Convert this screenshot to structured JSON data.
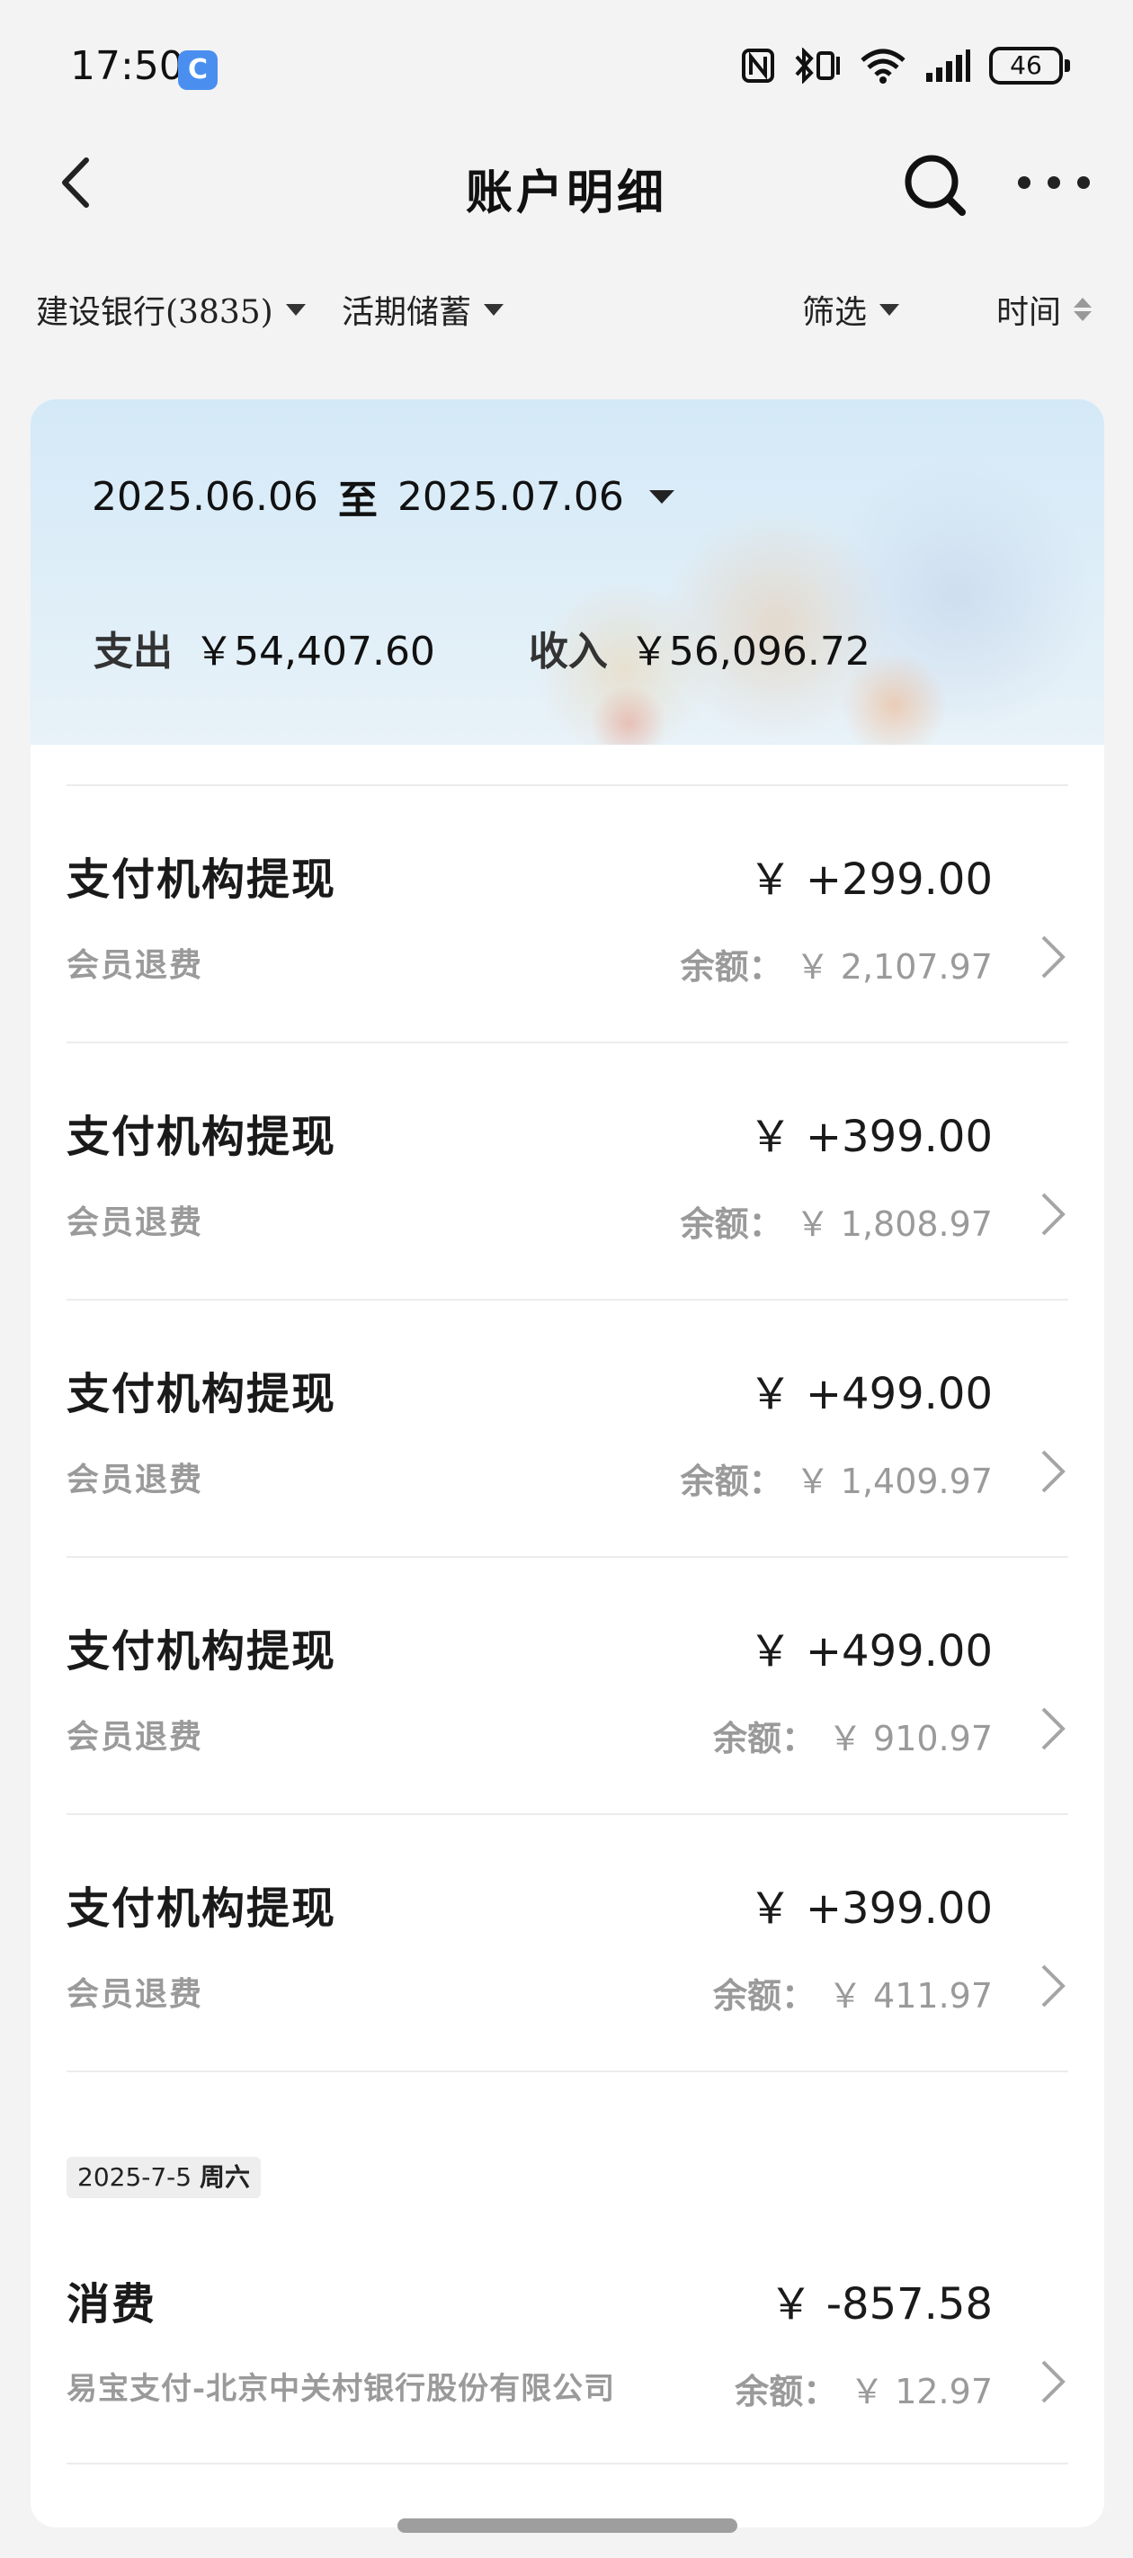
{
  "status_bar": {
    "time": "17:50",
    "app_icon_glyph": "C",
    "battery": "46"
  },
  "nav": {
    "title": "账户明细"
  },
  "filters": {
    "account": "建设银行(3835)",
    "account_type": "活期储蓄",
    "filter": "筛选",
    "sort": "时间"
  },
  "summary": {
    "start_date": "2025.06.06",
    "separator": "至",
    "end_date": "2025.07.06",
    "expense_label": "支出",
    "expense_amount": "￥54,407.60",
    "income_label": "收入",
    "income_amount": "￥56,096.72"
  },
  "transactions": [
    {
      "title": "支付机构提现",
      "amount": "￥ +299.00",
      "desc": "会员退费",
      "balance_label": "余额：",
      "balance": "￥ 2,107.97"
    },
    {
      "title": "支付机构提现",
      "amount": "￥ +399.00",
      "desc": "会员退费",
      "balance_label": "余额：",
      "balance": "￥ 1,808.97"
    },
    {
      "title": "支付机构提现",
      "amount": "￥ +499.00",
      "desc": "会员退费",
      "balance_label": "余额：",
      "balance": "￥ 1,409.97"
    },
    {
      "title": "支付机构提现",
      "amount": "￥ +499.00",
      "desc": "会员退费",
      "balance_label": "余额：",
      "balance": "￥ 910.97"
    },
    {
      "title": "支付机构提现",
      "amount": "￥ +399.00",
      "desc": "会员退费",
      "balance_label": "余额：",
      "balance": "￥ 411.97"
    }
  ],
  "date_group": {
    "date": "2025-7-5",
    "weekday": "周六"
  },
  "last_transaction": {
    "title": "消费",
    "amount": "￥ -857.58",
    "desc": "易宝支付-北京中关村银行股份有限公司",
    "balance_label": "余额：",
    "balance": "￥ 12.97"
  },
  "icons": {
    "back": "chevron-left-icon",
    "search": "search-icon",
    "more": "more-dots-icon",
    "row": "chevron-right-icon"
  }
}
